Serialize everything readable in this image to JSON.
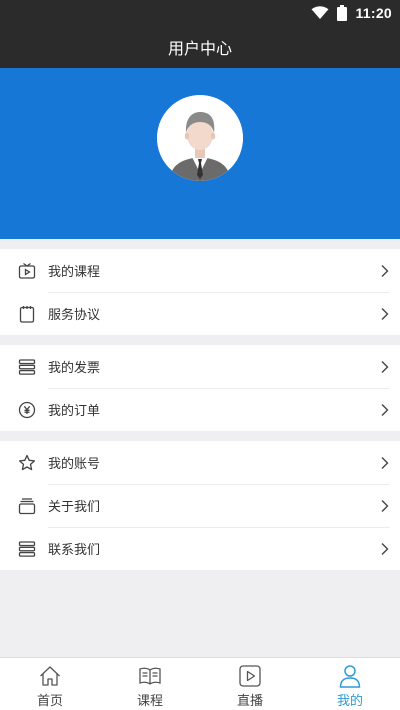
{
  "status_bar": {
    "time": "11:20"
  },
  "header": {
    "title": "用户中心"
  },
  "menu": {
    "groups": [
      {
        "items": [
          {
            "label": "我的课程",
            "icon": "tv-icon"
          },
          {
            "label": "服务协议",
            "icon": "notepad-icon"
          }
        ]
      },
      {
        "items": [
          {
            "label": "我的发票",
            "icon": "stack-lines-icon"
          },
          {
            "label": "我的订单",
            "icon": "yen-circle-icon"
          }
        ]
      },
      {
        "items": [
          {
            "label": "我的账号",
            "icon": "star-icon"
          },
          {
            "label": "关于我们",
            "icon": "layers-icon"
          },
          {
            "label": "联系我们",
            "icon": "stack-lines-icon"
          }
        ]
      }
    ]
  },
  "tabbar": {
    "tabs": [
      {
        "label": "首页",
        "icon": "home-icon"
      },
      {
        "label": "课程",
        "icon": "book-icon"
      },
      {
        "label": "直播",
        "icon": "play-icon"
      },
      {
        "label": "我的",
        "icon": "user-icon",
        "active": true
      }
    ]
  },
  "colors": {
    "header_bg": "#2b2b2b",
    "banner_bg": "#1677d7",
    "tab_active": "#2e9bd6"
  }
}
